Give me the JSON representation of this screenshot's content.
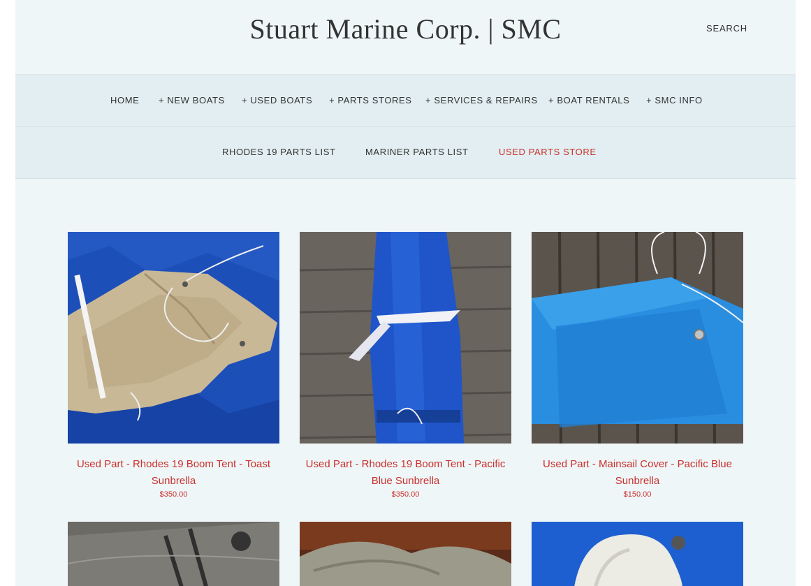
{
  "site": {
    "title": "Stuart Marine Corp. | SMC",
    "search_label": "SEARCH"
  },
  "nav_main": [
    {
      "label": "HOME"
    },
    {
      "label": "+ NEW BOATS"
    },
    {
      "label": "+ USED BOATS"
    },
    {
      "label": "+ PARTS STORES"
    },
    {
      "label": "+ SERVICES & REPAIRS"
    },
    {
      "label": "+ BOAT RENTALS"
    },
    {
      "label": "+ SMC INFO"
    }
  ],
  "nav_sub": [
    {
      "label": "RHODES 19 PARTS LIST"
    },
    {
      "label": "MARINER PARTS LIST"
    },
    {
      "label": "USED PARTS STORE",
      "active": true
    }
  ],
  "products": [
    {
      "title": "Used Part - Rhodes 19 Boom Tent - Toast Sunbrella",
      "price": "$350.00",
      "image": "tan-boom-tent-on-blue-cloth"
    },
    {
      "title": "Used Part - Rhodes 19 Boom Tent - Pacific Blue Sunbrella",
      "price": "$350.00",
      "image": "rolled-blue-boom-tent-on-deck"
    },
    {
      "title": "Used Part - Mainsail Cover - Pacific Blue Sunbrella",
      "price": "$150.00",
      "image": "blue-mainsail-cover-on-deck"
    },
    {
      "title": "",
      "price": "",
      "image": "gray-canvas-bag"
    },
    {
      "title": "",
      "price": "",
      "image": "gray-cover-on-wood-floor"
    },
    {
      "title": "",
      "price": "",
      "image": "white-sail-on-blue-cloth"
    }
  ],
  "colors": {
    "accent": "#c9302c",
    "page_bg": "#eff6f8",
    "nav_bg": "#e2eef1"
  }
}
